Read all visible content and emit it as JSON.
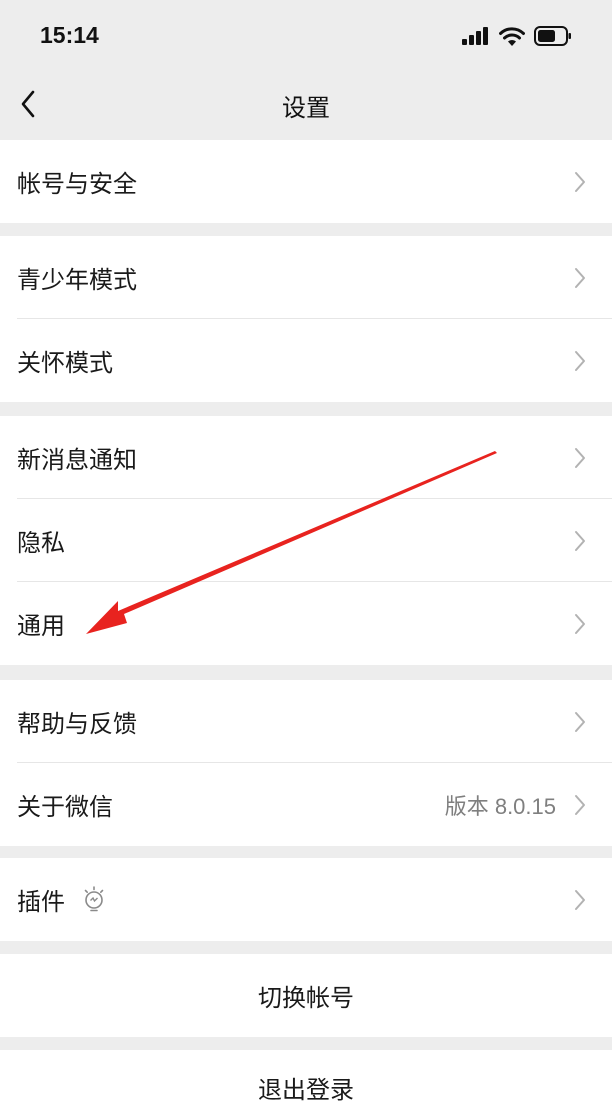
{
  "status_bar": {
    "time": "15:14"
  },
  "nav": {
    "title": "设置"
  },
  "groups": [
    {
      "items": [
        {
          "label": "帐号与安全"
        }
      ]
    },
    {
      "items": [
        {
          "label": "青少年模式"
        },
        {
          "label": "关怀模式"
        }
      ]
    },
    {
      "items": [
        {
          "label": "新消息通知"
        },
        {
          "label": "隐私"
        },
        {
          "label": "通用"
        }
      ]
    },
    {
      "items": [
        {
          "label": "帮助与反馈"
        },
        {
          "label": "关于微信",
          "value": "版本 8.0.15"
        }
      ]
    },
    {
      "items": [
        {
          "label": "插件"
        }
      ]
    }
  ],
  "actions": {
    "switch_account": "切换帐号",
    "logout": "退出登录"
  },
  "colors": {
    "background": "#ededed",
    "row": "#ffffff",
    "annotation_arrow": "#e8231f",
    "chevron": "#b2b2b2"
  },
  "icons": [
    "back-chevron-icon",
    "chevron-right-icon",
    "plugin-bulb-icon",
    "signal-icon",
    "wifi-icon",
    "battery-icon"
  ]
}
